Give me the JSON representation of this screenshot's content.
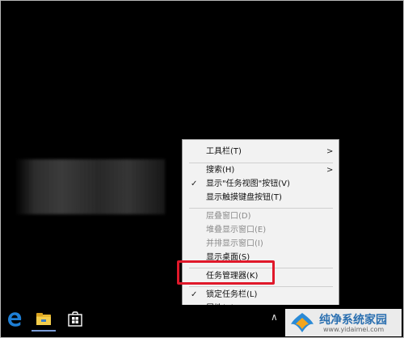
{
  "context_menu": {
    "items": [
      {
        "label": "工具栏(T)",
        "submenu": true,
        "checked": false,
        "disabled": false
      },
      {
        "label": "搜索(H)",
        "submenu": true,
        "checked": false,
        "disabled": false
      },
      {
        "label": "显示\"任务视图\"按钮(V)",
        "submenu": false,
        "checked": true,
        "disabled": false
      },
      {
        "label": "显示触摸键盘按钮(T)",
        "submenu": false,
        "checked": false,
        "disabled": false
      },
      {
        "label": "层叠窗口(D)",
        "submenu": false,
        "checked": false,
        "disabled": true
      },
      {
        "label": "堆叠显示窗口(E)",
        "submenu": false,
        "checked": false,
        "disabled": true
      },
      {
        "label": "并排显示窗口(I)",
        "submenu": false,
        "checked": false,
        "disabled": true
      },
      {
        "label": "显示桌面(S)",
        "submenu": false,
        "checked": false,
        "disabled": false
      },
      {
        "label": "任务管理器(K)",
        "submenu": false,
        "checked": false,
        "disabled": false,
        "highlighted": true
      },
      {
        "label": "锁定任务栏(L)",
        "submenu": false,
        "checked": true,
        "disabled": false
      },
      {
        "label": "属性(R)",
        "submenu": false,
        "checked": false,
        "disabled": false
      }
    ],
    "chevron": ">",
    "checkmark": "✓",
    "highlight_color": "#e0182a"
  },
  "taskbar": {
    "icons": [
      "edge-icon",
      "file-explorer-icon",
      "store-icon"
    ]
  },
  "watermark": {
    "title": "纯净系统家园",
    "url": "www.yidaimei.com"
  }
}
